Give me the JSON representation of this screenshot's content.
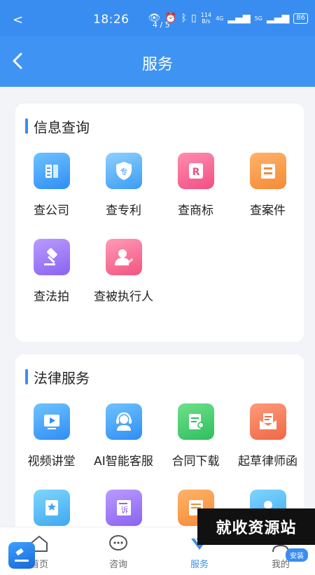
{
  "status_bar": {
    "back_glyph": "<",
    "time": "18:26",
    "page_indicator": "4 / 5",
    "net_speed_value": "114",
    "net_speed_unit": "B/s",
    "signal1": "4G",
    "signal2": "5G",
    "battery": "86",
    "icons": [
      "eye-icon",
      "alarm-icon",
      "bluetooth-icon",
      "vibrate-icon"
    ]
  },
  "header": {
    "title": "服务"
  },
  "sections": [
    {
      "title": "信息查询",
      "items": [
        {
          "label": "查公司",
          "icon": "company-icon"
        },
        {
          "label": "查专利",
          "icon": "patent-shield-icon",
          "glyph": "专"
        },
        {
          "label": "查商标",
          "icon": "trademark-icon",
          "glyph": "R"
        },
        {
          "label": "查案件",
          "icon": "case-icon"
        },
        {
          "label": "查法拍",
          "icon": "gavel-icon"
        },
        {
          "label": "查被执行人",
          "icon": "person-icon"
        }
      ]
    },
    {
      "title": "法律服务",
      "items": [
        {
          "label": "视频讲堂",
          "icon": "video-icon"
        },
        {
          "label": "AI智能客服",
          "icon": "headset-icon"
        },
        {
          "label": "合同下载",
          "icon": "contract-icon"
        },
        {
          "label": "起草律师函",
          "icon": "letter-icon"
        },
        {
          "label": "",
          "icon": "badge-icon"
        },
        {
          "label": "",
          "icon": "complaint-icon",
          "glyph": "诉"
        },
        {
          "label": "",
          "icon": "document-icon"
        },
        {
          "label": "",
          "icon": "profile-icon"
        }
      ]
    }
  ],
  "bottom_nav": [
    {
      "label": "首页",
      "icon": "home-icon"
    },
    {
      "label": "咨询",
      "icon": "chat-icon"
    },
    {
      "label": "服务",
      "icon": "service-icon",
      "active": true
    },
    {
      "label": "我的",
      "icon": "me-icon"
    }
  ],
  "install_badge": "安装",
  "watermark": "就收资源站",
  "colors": {
    "primary": "#3a8df0",
    "background": "#f3f4f8"
  }
}
